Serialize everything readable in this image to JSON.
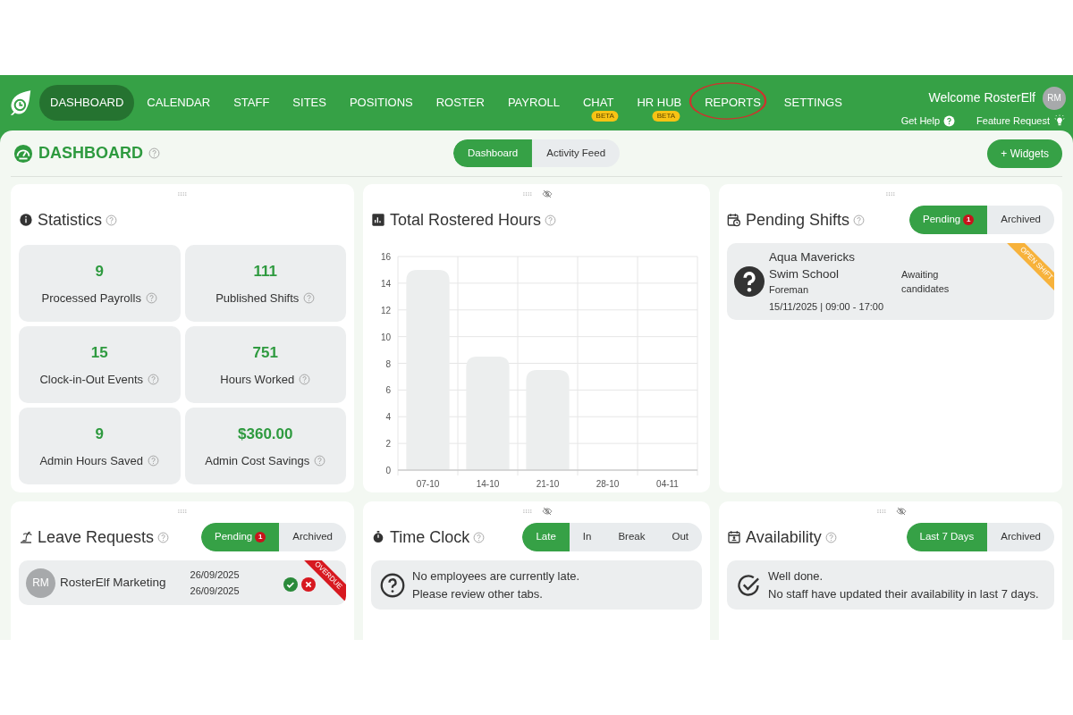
{
  "nav": {
    "items": [
      {
        "label": "DASHBOARD",
        "selected": true,
        "circled": false
      },
      {
        "label": "CALENDAR",
        "selected": false,
        "circled": false
      },
      {
        "label": "STAFF",
        "selected": false,
        "circled": false
      },
      {
        "label": "SITES",
        "selected": false,
        "circled": false
      },
      {
        "label": "POSITIONS",
        "selected": false,
        "circled": false
      },
      {
        "label": "ROSTER",
        "selected": false,
        "circled": false
      },
      {
        "label": "PAYROLL",
        "selected": false,
        "circled": false
      },
      {
        "label": "CHAT",
        "selected": false,
        "circled": false,
        "badge": "BETA"
      },
      {
        "label": "HR HUB",
        "selected": false,
        "circled": false,
        "badge": "BETA"
      },
      {
        "label": "REPORTS",
        "selected": false,
        "circled": true
      },
      {
        "label": "SETTINGS",
        "selected": false,
        "circled": false
      }
    ],
    "welcome": "Welcome RosterElf",
    "initials": "RM",
    "links": [
      {
        "label": "Get Help",
        "kind": "help"
      },
      {
        "label": "Feature Request",
        "kind": "idea"
      }
    ]
  },
  "page": {
    "title": "DASHBOARD",
    "views": [
      {
        "label": "Dashboard",
        "selected": true
      },
      {
        "label": "Activity Feed",
        "selected": false
      }
    ],
    "add_button": "+ Widgets"
  },
  "widgets": [
    {
      "kind": "statistics",
      "title": "Statistics",
      "hide_icon": false,
      "tiles": [
        {
          "value": "9",
          "label": "Processed Payrolls"
        },
        {
          "value": "111",
          "label": "Published Shifts"
        },
        {
          "value": "15",
          "label": "Clock-in-Out Events"
        },
        {
          "value": "751",
          "label": "Hours Worked"
        },
        {
          "value": "9",
          "label": "Admin Hours Saved"
        },
        {
          "value": "$360.00",
          "label": "Admin Cost Savings"
        }
      ]
    },
    {
      "kind": "chart",
      "title": "Total Rostered Hours",
      "hide_icon": true,
      "chart_data": {
        "type": "bar",
        "categories": [
          "07-10",
          "14-10",
          "21-10",
          "28-10",
          "04-11"
        ],
        "series": [
          {
            "color": "#eceeee",
            "values": [
              15,
              8.5,
              7.5,
              0,
              0
            ]
          }
        ],
        "ylim": [
          0,
          16
        ],
        "grid": true,
        "yticks": [
          0,
          2,
          4,
          6,
          8,
          10,
          12,
          14,
          16
        ]
      }
    },
    {
      "kind": "pending_shifts",
      "title": "Pending Shifts",
      "hide_icon": false,
      "tabs": [
        {
          "label": "Pending",
          "count": "1",
          "selected": true
        },
        {
          "label": "Archived",
          "selected": false
        }
      ],
      "shifts": [
        {
          "site": "Aqua Mavericks Swim School",
          "position": "Foreman",
          "time": "15/11/2025 | 09:00 - 17:00",
          "status": "Awaiting candidates",
          "ribbon": "OPEN SHIFT",
          "color": "#f7b23b"
        }
      ]
    },
    {
      "kind": "leave_requests",
      "title": "Leave Requests",
      "hide_icon": false,
      "tabs": [
        {
          "label": "Pending",
          "count": "1",
          "selected": true
        },
        {
          "label": "Archived",
          "selected": false
        }
      ],
      "requests": [
        {
          "initials": "RM",
          "name": "RosterElf Marketing",
          "from": "26/09/2025",
          "to": "26/09/2025",
          "ribbon": "OVERDUE",
          "color": "#d71920"
        }
      ]
    },
    {
      "kind": "time_clock",
      "title": "Time Clock",
      "hide_icon": true,
      "tabs": [
        {
          "label": "Late",
          "selected": true
        },
        {
          "label": "In",
          "selected": false
        },
        {
          "label": "Break",
          "selected": false
        },
        {
          "label": "Out",
          "selected": false
        }
      ],
      "message": {
        "lines": [
          "No employees are currently late.",
          "Please review other tabs."
        ]
      }
    },
    {
      "kind": "availability",
      "title": "Availability",
      "hide_icon": true,
      "tabs": [
        {
          "label": "Last 7 Days",
          "selected": true
        },
        {
          "label": "Archived",
          "selected": false
        }
      ],
      "message": {
        "lines": [
          "Well done.",
          "No staff have updated their availability in last 7 days."
        ]
      }
    }
  ]
}
